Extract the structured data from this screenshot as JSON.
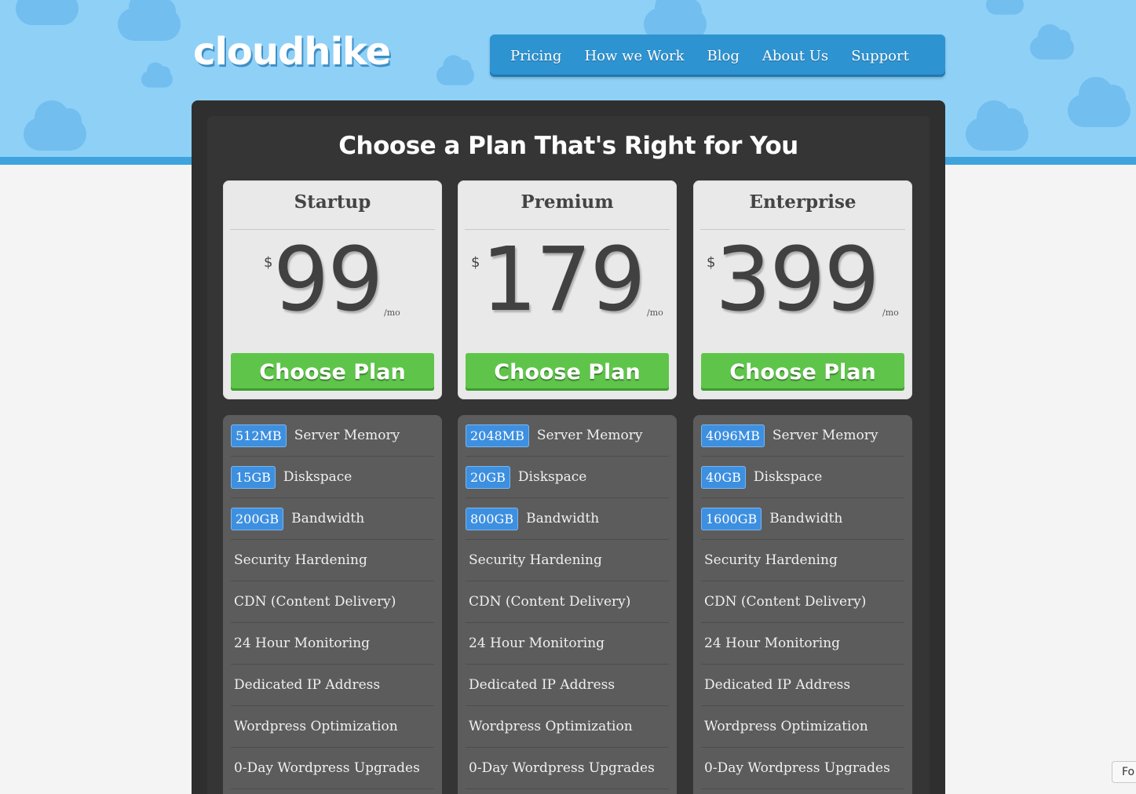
{
  "header": {
    "logo_text": "cloudhike",
    "nav": [
      "Pricing",
      "How we Work",
      "Blog",
      "About Us",
      "Support"
    ]
  },
  "main": {
    "title": "Choose a Plan That's Right for You",
    "currency": "$",
    "period": "/mo",
    "cta_label": "Choose Plan",
    "plans": [
      {
        "name": "Startup",
        "price": "99",
        "memory": "512MB",
        "disk": "15GB",
        "bandwidth": "200GB"
      },
      {
        "name": "Premium",
        "price": "179",
        "memory": "2048MB",
        "disk": "20GB",
        "bandwidth": "800GB"
      },
      {
        "name": "Enterprise",
        "price": "399",
        "memory": "4096MB",
        "disk": "40GB",
        "bandwidth": "1600GB"
      }
    ],
    "feature_labels": {
      "memory": "Server Memory",
      "disk": "Diskspace",
      "bandwidth": "Bandwidth"
    },
    "shared_features": [
      "Security Hardening",
      "CDN (Content Delivery)",
      "24 Hour Monitoring",
      "Dedicated IP Address",
      "Wordpress Optimization",
      "0-Day Wordpress Upgrades"
    ]
  },
  "corner_button_label": "Fo",
  "colors": {
    "sky": "#8fd0f7",
    "nav": "#2e93d1",
    "panel": "#2f2f2f",
    "cta_green": "#5ec54a",
    "badge_blue": "#3d8fe0"
  }
}
